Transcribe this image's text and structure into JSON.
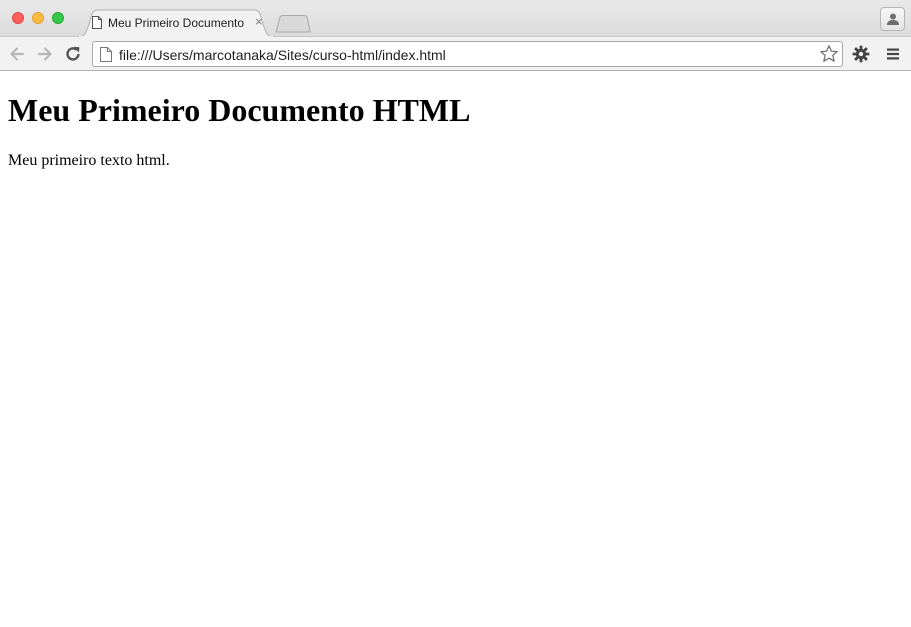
{
  "browser": {
    "window_controls": [
      "close",
      "minimize",
      "maximize"
    ],
    "tabs": [
      {
        "title": "Meu Primeiro Documento",
        "icon": "document-icon",
        "close_glyph": "×",
        "active": true
      }
    ],
    "address_bar": {
      "icon": "document-icon",
      "url": "file:///Users/marcotanaka/Sites/curso-html/index.html"
    },
    "toolbar_icons": [
      "back-arrow-icon",
      "forward-arrow-icon",
      "reload-icon",
      "bookmark-star-icon",
      "gear-icon",
      "hamburger-menu-icon",
      "profile-icon"
    ]
  },
  "page": {
    "heading": "Meu Primeiro Documento HTML",
    "paragraph": "Meu primeiro texto html."
  },
  "colors": {
    "close": "#fc605c",
    "minimize": "#fdbc40",
    "maximize": "#34c84a"
  }
}
